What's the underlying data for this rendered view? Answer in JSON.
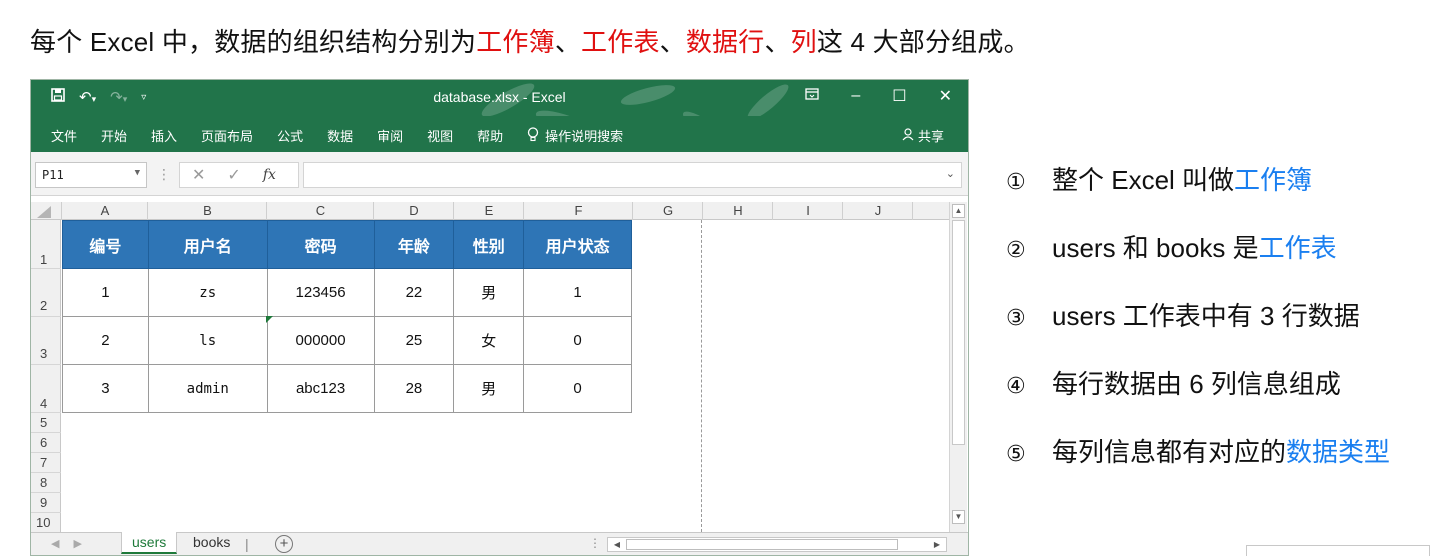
{
  "heading": {
    "prefix": "每个 Excel 中，数据的组织结构分别为",
    "term1": "工作簿",
    "sep1": "、",
    "term2": "工作表",
    "sep2": "、",
    "term3": "数据行",
    "sep3": "、",
    "term4": "列",
    "suffix": "这 4 大部分组成。"
  },
  "excel": {
    "title": "database.xlsx  -  Excel",
    "ribbon_tabs": [
      "文件",
      "开始",
      "插入",
      "页面布局",
      "公式",
      "数据",
      "审阅",
      "视图",
      "帮助"
    ],
    "tell_me": "操作说明搜索",
    "share": "共享",
    "name_box": "P11",
    "fx": "fx",
    "columns": [
      "A",
      "B",
      "C",
      "D",
      "E",
      "F",
      "G",
      "H",
      "I",
      "J"
    ],
    "rows": [
      "1",
      "2",
      "3",
      "4",
      "5",
      "6",
      "7",
      "8",
      "9",
      "10"
    ],
    "table": {
      "headers": [
        "编号",
        "用户名",
        "密码",
        "年龄",
        "性别",
        "用户状态"
      ],
      "rows": [
        [
          "1",
          "zs",
          "123456",
          "22",
          "男",
          "1"
        ],
        [
          "2",
          "ls",
          "000000",
          "25",
          "女",
          "0"
        ],
        [
          "3",
          "admin",
          "abc123",
          "28",
          "男",
          "0"
        ]
      ]
    },
    "sheets": [
      "users",
      "books"
    ],
    "active_sheet": "users",
    "theme_color": "#21744a",
    "header_fill": "#2e75b6"
  },
  "notes": [
    {
      "num": "①",
      "text": "整个 Excel 叫做",
      "hl": "工作簿"
    },
    {
      "num": "②",
      "text": "users 和 books 是",
      "hl": "工作表"
    },
    {
      "num": "③",
      "text": "users 工作表中有 3 行数据",
      "hl": ""
    },
    {
      "num": "④",
      "text": "每行数据由 6 列信息组成",
      "hl": ""
    },
    {
      "num": "⑤",
      "text": "每列信息都有对应的",
      "hl": "数据类型"
    }
  ]
}
